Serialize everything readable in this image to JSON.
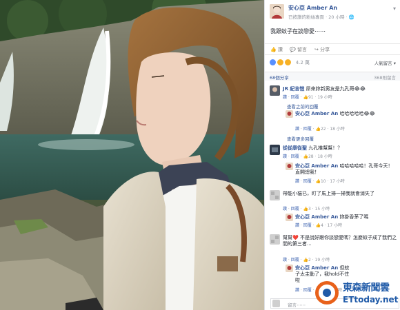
{
  "photo": {
    "alt": "selfie by waterfall"
  },
  "post": {
    "author": "安心亞 Amber An",
    "subtitle": "已按讚的粉絲專頁 · 20 小時 · 🌐",
    "text": "我跟蚊子在談戀愛⋯⋯",
    "actions": {
      "like": "讚",
      "comment": "留言",
      "share": "分享"
    },
    "reactions_count": "4.2 萬",
    "sort_label": "人氣留言 ▾",
    "shares": "68個分享",
    "comments_count": "368則留言"
  },
  "comments": [
    {
      "name": "JR 紀言愷",
      "text": "屌來妳新男友是九孔哥😂😂",
      "meta": {
        "like": "讚",
        "reply": "回覆",
        "likes": "91",
        "time": "19 小時"
      }
    },
    {
      "more": "查看之前的回覆"
    },
    {
      "name": "安心亞 Amber An",
      "text": "哈哈哈哈哈😂😂",
      "meta": {
        "like": "讚",
        "reply": "回覆",
        "likes": "22",
        "time": "18 小時"
      }
    },
    {
      "more": "查看更多回覆"
    },
    {
      "name": "從從康從聖",
      "text": "九孔推幫幫！？",
      "meta": {
        "like": "讚",
        "reply": "回覆",
        "likes": "28",
        "time": "18 小時"
      }
    },
    {
      "name": "安心亞 Amber An",
      "text": "哈哈哈哈哈！孔哥今天！直開總我！",
      "meta": {
        "like": "讚",
        "reply": "回覆",
        "likes": "10",
        "time": "17 小時"
      }
    },
    {
      "name": "",
      "text": "帶能小貓已，盯了馬上掃一掃我就會消失了",
      "meta": {
        "like": "讚",
        "reply": "回覆",
        "likes": "3",
        "time": "15 小時"
      }
    },
    {
      "name": "安心亞 Amber An",
      "text": "妳掛香茅了嗎",
      "meta": {
        "like": "讚",
        "reply": "回覆",
        "likes": "4",
        "time": "17 小時"
      }
    },
    {
      "name": "",
      "text": "幫幫❤️ 不是說好跟你談戀愛嗎？怎麼蚊子成了我們之間的第三者...",
      "meta": {
        "like": "讚",
        "reply": "回覆",
        "likes": "2",
        "time": "19 小時"
      }
    },
    {
      "name": "安心亞 Amber An",
      "text": "但蚊子太主動了，我hold不住啦",
      "meta": {
        "like": "讚",
        "reply": "回覆",
        "likes": "6",
        "time": "17 小時"
      }
    }
  ],
  "reply_placeholder": "留言⋯⋯",
  "watermark": {
    "cn": "東森新聞雲",
    "en": "ETtoday.net"
  }
}
